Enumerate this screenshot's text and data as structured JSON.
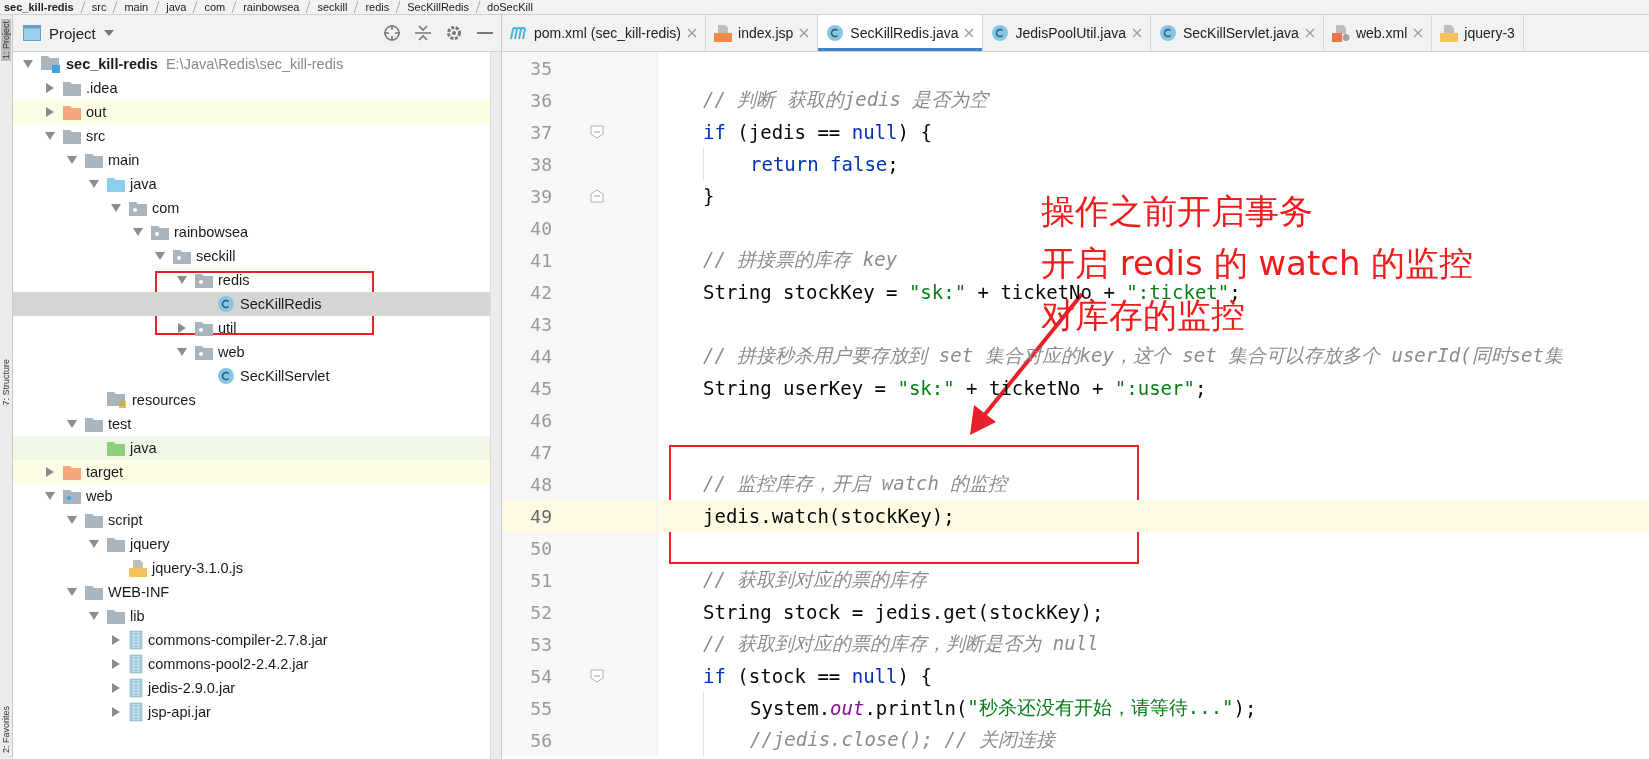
{
  "breadcrumb": [
    "sec_kill-redis",
    "src",
    "main",
    "java",
    "com",
    "rainbowsea",
    "seckill",
    "redis",
    "SecKillRedis",
    "doSecKill"
  ],
  "side_strip": [
    {
      "label": "1: Project",
      "selected": true
    },
    {
      "label": "7: Structure",
      "selected": false
    },
    {
      "label": "2: Favorites",
      "selected": false
    }
  ],
  "project_panel": {
    "title": "Project",
    "tree": [
      {
        "label": "sec_kill-redis",
        "path": "E:\\Java\\Redis\\sec_kill-redis",
        "kind": "module",
        "expanded": true,
        "selected": false,
        "children": [
          {
            "label": ".idea",
            "kind": "folder",
            "expanded": false,
            "selected": false
          },
          {
            "label": "out",
            "kind": "excluded",
            "expanded": false,
            "selected": false
          },
          {
            "label": "src",
            "kind": "folder",
            "expanded": true,
            "selected": false,
            "children": [
              {
                "label": "main",
                "kind": "folder",
                "expanded": true,
                "selected": false,
                "children": [
                  {
                    "label": "java",
                    "kind": "source",
                    "expanded": true,
                    "selected": false,
                    "children": [
                      {
                        "label": "com",
                        "kind": "package",
                        "expanded": true,
                        "selected": false,
                        "children": [
                          {
                            "label": "rainbowsea",
                            "kind": "package",
                            "expanded": true,
                            "selected": false,
                            "children": [
                              {
                                "label": "seckill",
                                "kind": "package",
                                "expanded": true,
                                "selected": false,
                                "children": [
                                  {
                                    "label": "redis",
                                    "kind": "package",
                                    "expanded": true,
                                    "selected": false,
                                    "children": [
                                      {
                                        "label": "SecKillRedis",
                                        "kind": "class",
                                        "selected": true
                                      }
                                    ]
                                  },
                                  {
                                    "label": "util",
                                    "kind": "package",
                                    "expanded": false,
                                    "selected": false
                                  },
                                  {
                                    "label": "web",
                                    "kind": "package",
                                    "expanded": true,
                                    "selected": false,
                                    "children": [
                                      {
                                        "label": "SecKillServlet",
                                        "kind": "class",
                                        "selected": false
                                      }
                                    ]
                                  }
                                ]
                              }
                            ]
                          }
                        ]
                      }
                    ]
                  },
                  {
                    "label": "resources",
                    "kind": "resources",
                    "selected": false
                  }
                ]
              },
              {
                "label": "test",
                "kind": "folder",
                "expanded": true,
                "selected": false,
                "children": [
                  {
                    "label": "java",
                    "kind": "test-source",
                    "selected": false
                  }
                ]
              }
            ]
          },
          {
            "label": "target",
            "kind": "excluded",
            "expanded": false,
            "selected": false
          },
          {
            "label": "web",
            "kind": "web",
            "expanded": true,
            "selected": false,
            "children": [
              {
                "label": "script",
                "kind": "folder",
                "expanded": true,
                "selected": false,
                "children": [
                  {
                    "label": "jquery",
                    "kind": "folder",
                    "expanded": true,
                    "selected": false,
                    "children": [
                      {
                        "label": "jquery-3.1.0.js",
                        "kind": "js",
                        "selected": false
                      }
                    ]
                  }
                ]
              },
              {
                "label": "WEB-INF",
                "kind": "folder",
                "expanded": true,
                "selected": false,
                "children": [
                  {
                    "label": "lib",
                    "kind": "folder",
                    "expanded": true,
                    "selected": false,
                    "children": [
                      {
                        "label": "commons-compiler-2.7.8.jar",
                        "kind": "jar",
                        "expanded": false,
                        "selected": false
                      },
                      {
                        "label": "commons-pool2-2.4.2.jar",
                        "kind": "jar",
                        "expanded": false,
                        "selected": false
                      },
                      {
                        "label": "jedis-2.9.0.jar",
                        "kind": "jar",
                        "expanded": false,
                        "selected": false
                      },
                      {
                        "label": "jsp-api.jar",
                        "kind": "jar",
                        "expanded": false,
                        "selected": false
                      }
                    ]
                  }
                ]
              }
            ]
          }
        ]
      }
    ]
  },
  "tabs": [
    {
      "label": "pom.xml (sec_kill-redis)",
      "kind": "maven",
      "selected": false,
      "closable": true
    },
    {
      "label": "index.jsp",
      "kind": "jsp",
      "selected": false,
      "closable": true
    },
    {
      "label": "SecKillRedis.java",
      "kind": "class",
      "selected": true,
      "closable": true
    },
    {
      "label": "JedisPoolUtil.java",
      "kind": "class",
      "selected": false,
      "closable": true
    },
    {
      "label": "SecKillServlet.java",
      "kind": "class",
      "selected": false,
      "closable": true
    },
    {
      "label": "web.xml",
      "kind": "xml",
      "selected": false,
      "closable": true
    },
    {
      "label": "jquery-3",
      "kind": "js",
      "selected": false,
      "closable": false
    }
  ],
  "code": [
    {
      "number": "35",
      "current": false
    },
    {
      "number": "36",
      "current": false,
      "tokens": [
        {
          "kind": "comment",
          "text": "// 判断 获取的jedis 是否为空"
        }
      ]
    },
    {
      "number": "37",
      "current": false,
      "fold_start": true,
      "tokens": [
        {
          "kind": "keyword",
          "text": "if"
        },
        {
          "kind": "plain",
          "text": " (jedis == "
        },
        {
          "kind": "keyword",
          "text": "null"
        },
        {
          "kind": "plain",
          "text": ") {"
        }
      ],
      "children": [
        {
          "number": "38",
          "current": false,
          "tokens": [
            {
              "kind": "keyword",
              "text": "return false"
            },
            {
              "kind": "plain",
              "text": ";"
            }
          ]
        }
      ]
    },
    {
      "number": "39",
      "current": false,
      "fold_end": true,
      "tokens": [
        {
          "kind": "plain",
          "text": "}"
        }
      ]
    },
    {
      "number": "40",
      "current": false
    },
    {
      "number": "41",
      "current": false,
      "tokens": [
        {
          "kind": "comment",
          "text": "// 拼接票的库存 key"
        }
      ]
    },
    {
      "number": "42",
      "current": false,
      "tokens": [
        {
          "kind": "plain",
          "text": "String stockKey = "
        },
        {
          "kind": "string",
          "text": "\"sk:\""
        },
        {
          "kind": "plain",
          "text": " + ticketNo + "
        },
        {
          "kind": "string",
          "text": "\":ticket\""
        },
        {
          "kind": "plain",
          "text": ";"
        }
      ]
    },
    {
      "number": "43",
      "current": false
    },
    {
      "number": "44",
      "current": false,
      "tokens": [
        {
          "kind": "comment",
          "text": "// 拼接秒杀用户要存放到 set 集合对应的key，这个 set 集合可以存放多个 userId(同时set集"
        }
      ]
    },
    {
      "number": "45",
      "current": false,
      "tokens": [
        {
          "kind": "plain",
          "text": "String userKey = "
        },
        {
          "kind": "string",
          "text": "\"sk:\""
        },
        {
          "kind": "plain",
          "text": " + ticketNo + "
        },
        {
          "kind": "string",
          "text": "\":user\""
        },
        {
          "kind": "plain",
          "text": ";"
        }
      ]
    },
    {
      "number": "46",
      "current": false
    },
    {
      "number": "47",
      "current": false
    },
    {
      "number": "48",
      "current": false,
      "tokens": [
        {
          "kind": "comment",
          "text": "// 监控库存，开启 watch 的监控"
        }
      ]
    },
    {
      "number": "49",
      "current": true,
      "tokens": [
        {
          "kind": "plain",
          "text": "jedis.watch(stockKey);"
        }
      ]
    },
    {
      "number": "50",
      "current": false
    },
    {
      "number": "51",
      "current": false,
      "tokens": [
        {
          "kind": "comment",
          "text": "// 获取到对应的票的库存"
        }
      ]
    },
    {
      "number": "52",
      "current": false,
      "tokens": [
        {
          "kind": "plain",
          "text": "String stock = jedis.get(stockKey);"
        }
      ]
    },
    {
      "number": "53",
      "current": false,
      "tokens": [
        {
          "kind": "comment",
          "text": "// 获取到对应的票的库存，判断是否为 null"
        }
      ]
    },
    {
      "number": "54",
      "current": false,
      "fold_start": true,
      "tokens": [
        {
          "kind": "keyword",
          "text": "if"
        },
        {
          "kind": "plain",
          "text": " (stock == "
        },
        {
          "kind": "keyword",
          "text": "null"
        },
        {
          "kind": "plain",
          "text": ") {"
        }
      ],
      "children": [
        {
          "number": "55",
          "current": false,
          "tokens": [
            {
              "kind": "plain",
              "text": "System."
            },
            {
              "kind": "static",
              "text": "out"
            },
            {
              "kind": "plain",
              "text": ".println("
            },
            {
              "kind": "string",
              "text": "\"秒杀还没有开始，请等待...\""
            },
            {
              "kind": "plain",
              "text": ");"
            }
          ]
        },
        {
          "number": "56",
          "current": false,
          "tokens": [
            {
              "kind": "comment",
              "text": "//jedis.close(); // 关闭连接"
            }
          ]
        }
      ]
    }
  ],
  "annotation": {
    "lines": [
      "操作之前开启事务",
      "开启 redis 的 watch 的监控",
      "对库存的监控"
    ]
  }
}
